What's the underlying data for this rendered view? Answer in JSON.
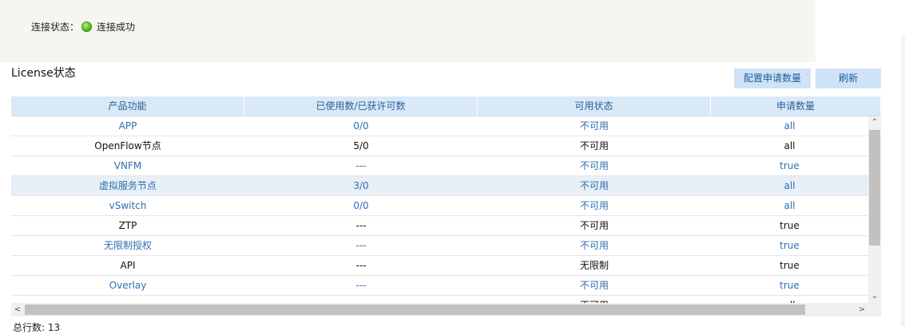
{
  "status": {
    "label": "连接状态：",
    "value": "连接成功",
    "indicator_color": "#4cbb17"
  },
  "section_title": "License状态",
  "buttons": {
    "config": "配置申请数量",
    "refresh": "刷新"
  },
  "table": {
    "columns": [
      "产品功能",
      "已使用数/已获许可数",
      "可用状态",
      "申请数量"
    ],
    "rows": [
      {
        "name": "APP",
        "usage": "0/0",
        "status": "不可用",
        "request": "all",
        "style": "blue"
      },
      {
        "name": "OpenFlow节点",
        "usage": "5/0",
        "status": "不可用",
        "request": "all",
        "style": "black"
      },
      {
        "name": "VNFM",
        "usage": "---",
        "status": "不可用",
        "request": "true",
        "style": "blue"
      },
      {
        "name": "虚拟服务节点",
        "usage": "3/0",
        "status": "不可用",
        "request": "all",
        "style": "blue selected"
      },
      {
        "name": "vSwitch",
        "usage": "0/0",
        "status": "不可用",
        "request": "all",
        "style": "blue"
      },
      {
        "name": "ZTP",
        "usage": "---",
        "status": "不可用",
        "request": "true",
        "style": "black"
      },
      {
        "name": "无限制授权",
        "usage": "---",
        "status": "不可用",
        "request": "true",
        "style": "blue"
      },
      {
        "name": "API",
        "usage": "---",
        "status": "无限制",
        "request": "true",
        "style": "black"
      },
      {
        "name": "Overlay",
        "usage": "---",
        "status": "不可用",
        "request": "true",
        "style": "blue"
      },
      {
        "name": "",
        "usage": "",
        "status": "不可用",
        "request": "all",
        "style": "black"
      }
    ]
  },
  "footer": "总行数: 13",
  "colors": {
    "accent": "#2e6fb0",
    "header_bg": "#d9e9f7",
    "button_bg": "#cfe3f7",
    "selected_row": "#e8eff6"
  }
}
